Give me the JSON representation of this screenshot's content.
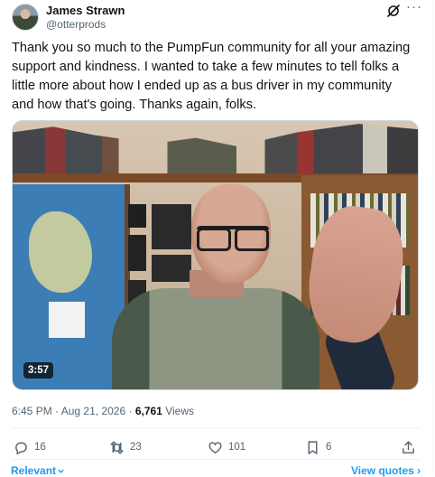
{
  "author": {
    "name": "James Strawn",
    "handle": "@otterprods"
  },
  "tweet": {
    "text": "Thank you so much to the PumpFun community for all your amazing support and kindness. I wanted to take a few minutes to tell folks a little more about how I ended up as a bus driver in my community and how that's going. Thanks again, folks."
  },
  "video": {
    "duration": "3:57"
  },
  "meta": {
    "time": "6:45 PM",
    "separator": "·",
    "date": "Aug 21, 2026",
    "views_count": "6,761",
    "views_label": "Views"
  },
  "actions": {
    "replies": "16",
    "retweets": "23",
    "likes": "101",
    "bookmarks": "6"
  },
  "footer": {
    "relevant": "Relevant",
    "view_quotes": "View quotes ›"
  },
  "icons": [
    "grok-icon",
    "more-icon",
    "reply-icon",
    "retweet-icon",
    "like-icon",
    "bookmark-icon",
    "share-icon",
    "chevron-down-icon"
  ],
  "colors": {
    "accent": "#1d9bf0",
    "muted": "#536471",
    "text": "#0f1419"
  }
}
